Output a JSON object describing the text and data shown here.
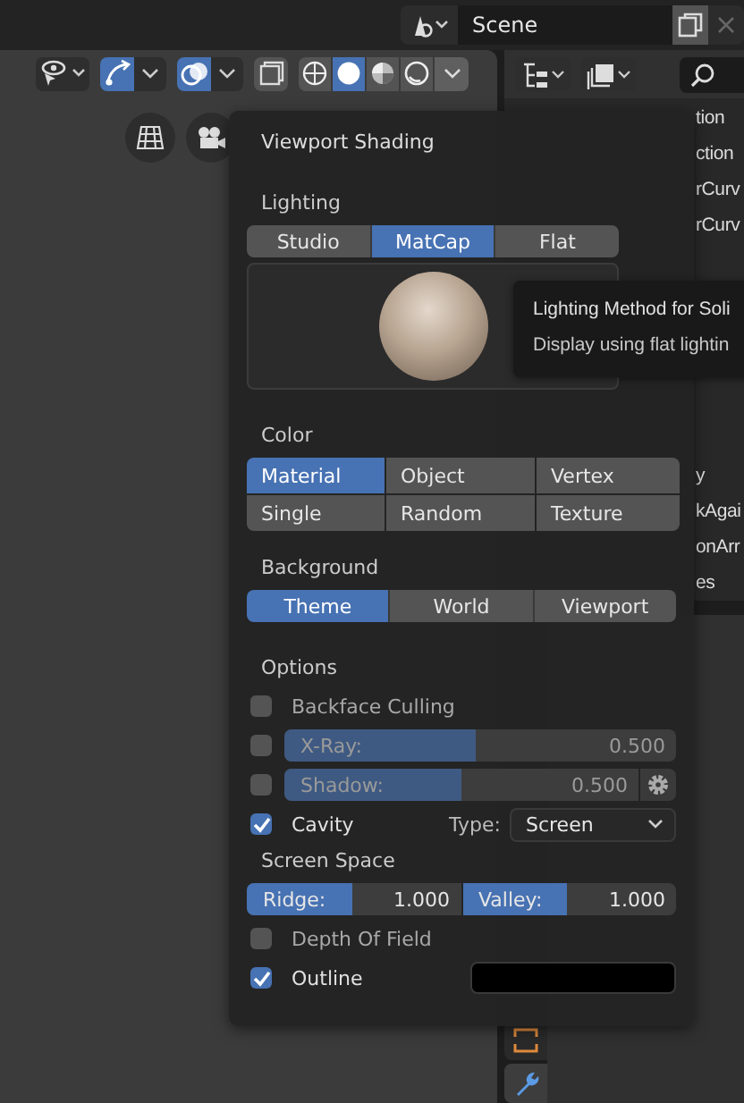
{
  "topbar": {
    "scene": "Scene"
  },
  "viewport_header": {
    "gizmos_on": true,
    "overlays_on": true,
    "xray_on": false,
    "shading_modes": [
      {
        "selected": false
      },
      {
        "selected": true
      },
      {
        "selected": false
      },
      {
        "selected": false
      }
    ],
    "shading_popover_open": true
  },
  "outliner": {
    "rows_top": [
      "tion",
      "ction",
      "rCurv",
      "rCurv"
    ],
    "rows_bottom": [
      "y",
      "kAgai",
      "onArr",
      "es"
    ]
  },
  "properties_tabs": [
    {
      "kind": "constraint",
      "selected": false
    },
    {
      "kind": "modifier",
      "selected": true
    }
  ],
  "popover": {
    "title": "Viewport Shading",
    "lighting": {
      "label": "Lighting",
      "options": [
        {
          "label": "Studio",
          "selected": false
        },
        {
          "label": "MatCap",
          "selected": true
        },
        {
          "label": "Flat",
          "selected": false
        }
      ]
    },
    "color": {
      "label": "Color",
      "options": [
        {
          "label": "Material",
          "selected": true
        },
        {
          "label": "Object",
          "selected": false
        },
        {
          "label": "Vertex",
          "selected": false
        },
        {
          "label": "Single",
          "selected": false
        },
        {
          "label": "Random",
          "selected": false
        },
        {
          "label": "Texture",
          "selected": false
        }
      ]
    },
    "background": {
      "label": "Background",
      "options": [
        {
          "label": "Theme",
          "selected": true
        },
        {
          "label": "World",
          "selected": false
        },
        {
          "label": "Viewport",
          "selected": false
        }
      ]
    },
    "options": {
      "label": "Options",
      "rows": [
        {
          "kind": "check",
          "label": "Backface Culling",
          "checked": false
        },
        {
          "kind": "slider",
          "label": "X-Ray:",
          "value": "0.500",
          "level": 0.49,
          "checked": false
        },
        {
          "kind": "slider_gear",
          "label": "Shadow:",
          "value": "0.500",
          "level": 0.5,
          "checked": false
        },
        {
          "kind": "check_dropdown",
          "label": "Cavity",
          "checked": true,
          "field_label": "Type:",
          "field_value": "Screen"
        }
      ]
    },
    "screen_space": {
      "label": "Screen Space",
      "sliders": [
        {
          "label": "Ridge:",
          "value": "1.000",
          "level": 0.49
        },
        {
          "label": "Valley:",
          "value": "1.000",
          "level": 0.49
        }
      ]
    },
    "extra_rows": [
      {
        "kind": "check",
        "label": "Depth Of Field",
        "checked": false
      },
      {
        "kind": "check_color",
        "label": "Outline",
        "checked": true,
        "color": "#000000"
      }
    ]
  },
  "tooltip": {
    "title": "Lighting Method for Soli",
    "description": "Display using flat lightin"
  }
}
